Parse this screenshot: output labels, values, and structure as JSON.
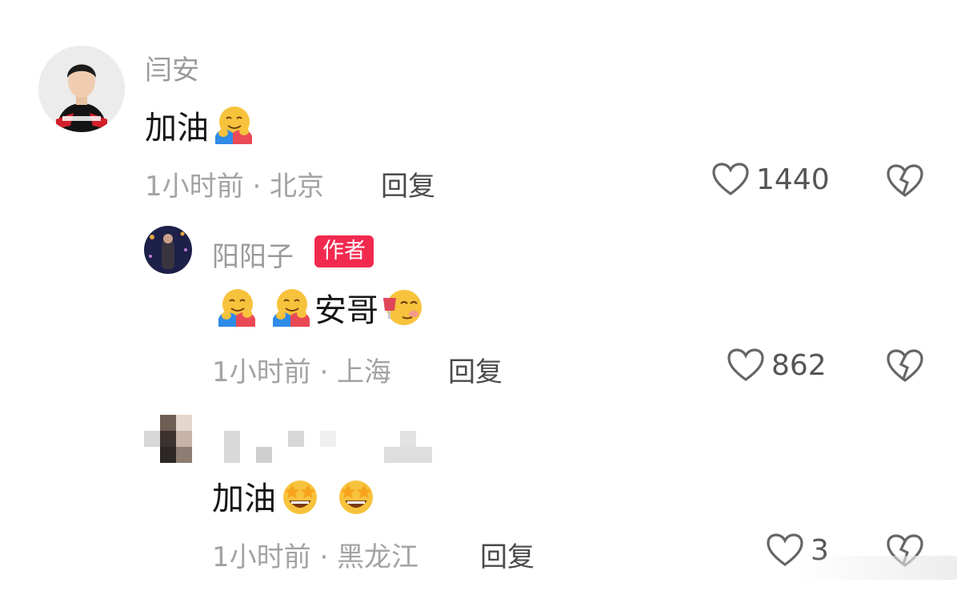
{
  "comments": [
    {
      "username": "闫安",
      "text": "加油",
      "emojis": [
        "hugging-face"
      ],
      "meta": "1小时前 · 北京",
      "reply": "回复",
      "likes": "1440"
    },
    {
      "username": "阳阳子",
      "badge": "作者",
      "text": "安哥",
      "emojis_before": [
        "hugging-face",
        "hugging-face"
      ],
      "emojis_after": [
        "drinking-face"
      ],
      "meta": "1小时前 · 上海",
      "reply": "回复",
      "likes": "862"
    },
    {
      "username": "",
      "text": "加油",
      "emojis": [
        "star-struck",
        "star-struck"
      ],
      "meta": "1小时前 · 黑龙江",
      "reply": "回复",
      "likes": "3"
    }
  ],
  "colors": {
    "badge": "#f2294f",
    "meta_text": "#a3a3a3",
    "username": "#9a9a9a",
    "body_text": "#161616"
  }
}
